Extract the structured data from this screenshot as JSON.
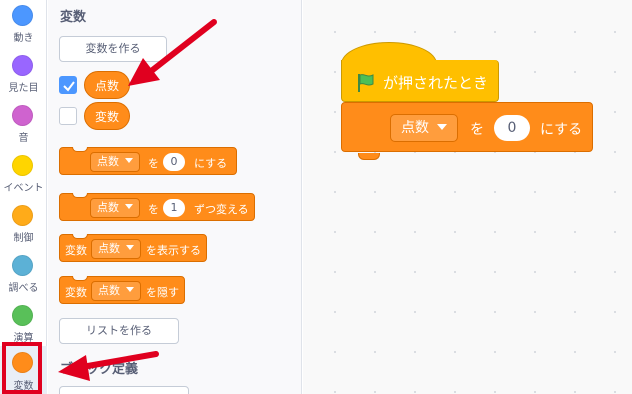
{
  "categories": [
    {
      "label": "動き",
      "color": "#4c97ff",
      "icon": "motion-dot-icon"
    },
    {
      "label": "見た目",
      "color": "#9966ff",
      "icon": "looks-dot-icon"
    },
    {
      "label": "音",
      "color": "#cf63cf",
      "icon": "sound-dot-icon"
    },
    {
      "label": "イベント",
      "color": "#ffd500",
      "icon": "events-dot-icon"
    },
    {
      "label": "制御",
      "color": "#ffab19",
      "icon": "control-dot-icon"
    },
    {
      "label": "調べる",
      "color": "#5cb1d6",
      "icon": "sensing-dot-icon"
    },
    {
      "label": "演算",
      "color": "#59c059",
      "icon": "operators-dot-icon"
    },
    {
      "label": "変数",
      "color": "#ff8c1a",
      "icon": "variables-dot-icon",
      "selected": true
    }
  ],
  "palette": {
    "section_title": "変数",
    "make_variable": "変数を作る",
    "variables": [
      {
        "name": "点数",
        "checked": true
      },
      {
        "name": "変数",
        "checked": false
      }
    ],
    "blocks": {
      "set": {
        "var": "点数",
        "word": "を",
        "value": "0",
        "suffix": "にする"
      },
      "change": {
        "var": "点数",
        "word": "を",
        "value": "1",
        "suffix": "ずつ変える"
      },
      "show": {
        "prefix": "変数",
        "var": "点数",
        "suffix": "を表示する"
      },
      "hide": {
        "prefix": "変数",
        "var": "点数",
        "suffix": "を隠す"
      }
    },
    "make_list": "リストを作る",
    "section_title2": "ブロック定義"
  },
  "script": {
    "hat": "が押されたとき",
    "set": {
      "var": "点数",
      "word": "を",
      "value": "0",
      "suffix": "にする"
    }
  },
  "colors": {
    "variables": "#ff8c1a",
    "events": "#ffbf00",
    "annotation": "#e0001f",
    "flag": "#4cbf56"
  }
}
